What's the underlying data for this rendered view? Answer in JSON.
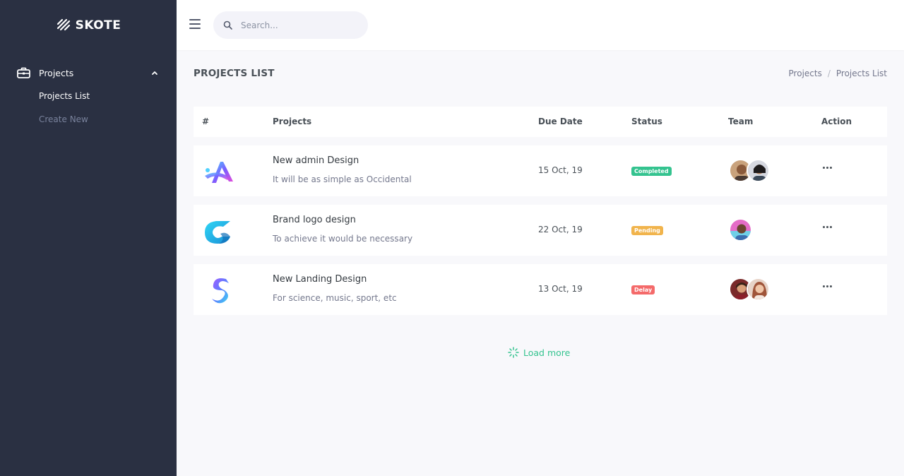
{
  "brand": {
    "name": "SKOTE"
  },
  "sidebar": {
    "menu": {
      "label": "Projects",
      "icon": "briefcase-icon"
    },
    "sub_items": [
      {
        "label": "Projects List",
        "active": true
      },
      {
        "label": "Create New",
        "active": false
      }
    ]
  },
  "topbar": {
    "search_placeholder": "Search..."
  },
  "page": {
    "title": "PROJECTS LIST"
  },
  "breadcrumb": {
    "items": [
      "Projects",
      "Projects List"
    ],
    "separator": "/"
  },
  "table": {
    "headers": {
      "num": "#",
      "projects": "Projects",
      "due_date": "Due Date",
      "status": "Status",
      "team": "Team",
      "action": "Action"
    },
    "rows": [
      {
        "name": "New admin Design",
        "desc": "It will be as simple as Occidental",
        "date": "15 Oct, 19",
        "status": "Completed",
        "status_color": "#34c38f",
        "team_count": 2
      },
      {
        "name": "Brand logo design",
        "desc": "To achieve it would be necessary",
        "date": "22 Oct, 19",
        "status": "Pending",
        "status_color": "#f1b44c",
        "team_count": 1
      },
      {
        "name": "New Landing Design",
        "desc": "For science, music, sport, etc",
        "date": "13 Oct, 19",
        "status": "Delay",
        "status_color": "#f46a6a",
        "team_count": 2
      }
    ]
  },
  "load_more": {
    "label": "Load more"
  },
  "colors": {
    "sidebar": "#2a3042",
    "accent": "#34c38f",
    "warning": "#f1b44c",
    "danger": "#f46a6a"
  }
}
